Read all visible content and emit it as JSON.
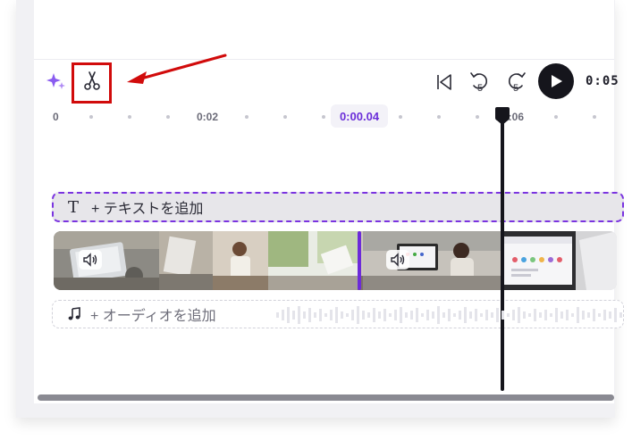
{
  "toolbar": {
    "ai_icon": "sparkle-icon",
    "split_icon": "scissors-icon",
    "skip_start_icon": "skip-to-start-icon",
    "rewind_icon": "rewind-5-icon",
    "rewind_seconds": "5",
    "forward_icon": "forward-5-icon",
    "forward_seconds": "5",
    "play_icon": "play-icon",
    "time_display": "0:05"
  },
  "ruler": {
    "labels": [
      "0",
      "0:02",
      "0:06"
    ],
    "current_time": "0:00.04"
  },
  "tracks": {
    "text_track": {
      "icon": "T",
      "label": "+ テキストを追加"
    },
    "video_track": {
      "volume_icon": "speaker-icon"
    },
    "audio_track": {
      "icon": "music-note-icon",
      "label": "+ オーディオを追加"
    }
  },
  "annotation": {
    "highlight_color": "#d10b0b"
  },
  "colors": {
    "accent": "#7a33e0",
    "playhead": "#15151c"
  }
}
